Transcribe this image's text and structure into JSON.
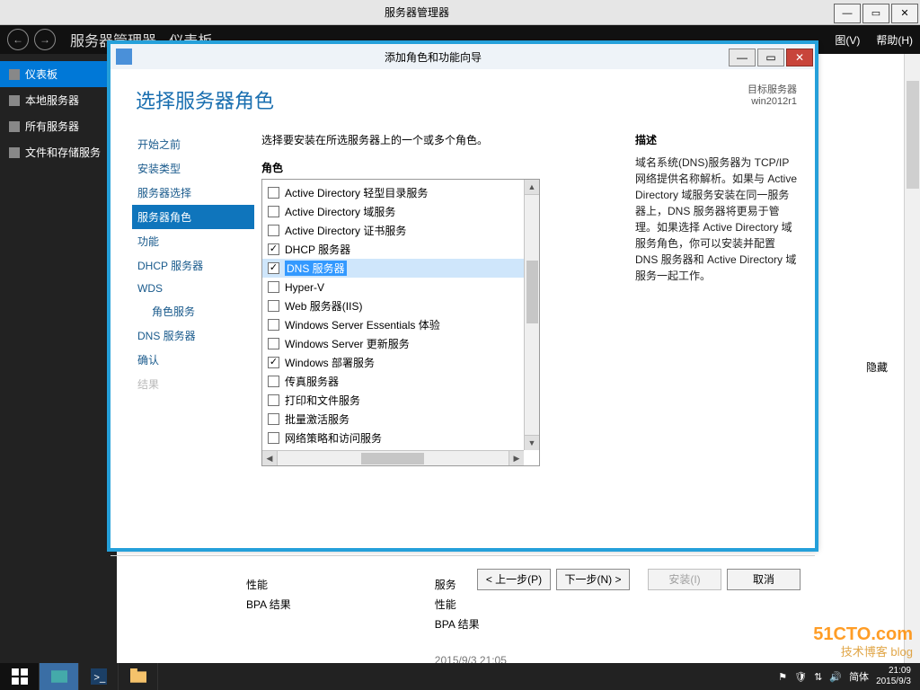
{
  "outer": {
    "title": "服务器管理器",
    "menus": {
      "view": "图(V)",
      "help": "帮助(H)"
    },
    "breadcrumb_hint": "服务器管理器 · 仪表板"
  },
  "leftnav": {
    "items": [
      {
        "label": "仪表板",
        "selected": true
      },
      {
        "label": "本地服务器",
        "selected": false
      },
      {
        "label": "所有服务器",
        "selected": false
      },
      {
        "label": "文件和存储服务",
        "selected": false
      }
    ]
  },
  "main": {
    "hide": "隐藏",
    "tile1": {
      "a": "性能",
      "b": "BPA 结果"
    },
    "tile2": {
      "a": "服务",
      "b": "性能",
      "c": "BPA 结果",
      "ts": "2015/9/3 21:05"
    }
  },
  "wizard": {
    "title": "添加角色和功能向导",
    "heading": "选择服务器角色",
    "dest_label": "目标服务器",
    "dest_value": "win2012r1",
    "steps": [
      {
        "label": "开始之前",
        "state": "link"
      },
      {
        "label": "安装类型",
        "state": "link"
      },
      {
        "label": "服务器选择",
        "state": "link"
      },
      {
        "label": "服务器角色",
        "state": "current"
      },
      {
        "label": "功能",
        "state": "link"
      },
      {
        "label": "DHCP 服务器",
        "state": "link"
      },
      {
        "label": "WDS",
        "state": "link"
      },
      {
        "label": "角色服务",
        "state": "link",
        "indent": true
      },
      {
        "label": "DNS 服务器",
        "state": "link"
      },
      {
        "label": "确认",
        "state": "link"
      },
      {
        "label": "结果",
        "state": "disabled"
      }
    ],
    "prompt": "选择要安装在所选服务器上的一个或多个角色。",
    "roles_header": "角色",
    "roles": [
      {
        "label": "Active Directory 轻型目录服务",
        "checked": false
      },
      {
        "label": "Active Directory 域服务",
        "checked": false
      },
      {
        "label": "Active Directory 证书服务",
        "checked": false
      },
      {
        "label": "DHCP 服务器",
        "checked": true
      },
      {
        "label": "DNS 服务器",
        "checked": true,
        "selected": true
      },
      {
        "label": "Hyper-V",
        "checked": false
      },
      {
        "label": "Web 服务器(IIS)",
        "checked": false
      },
      {
        "label": "Windows Server Essentials 体验",
        "checked": false
      },
      {
        "label": "Windows Server 更新服务",
        "checked": false
      },
      {
        "label": "Windows 部署服务",
        "checked": true
      },
      {
        "label": "传真服务器",
        "checked": false
      },
      {
        "label": "打印和文件服务",
        "checked": false
      },
      {
        "label": "批量激活服务",
        "checked": false
      },
      {
        "label": "网络策略和访问服务",
        "checked": false
      }
    ],
    "desc_header": "描述",
    "desc_text": "域名系统(DNS)服务器为 TCP/IP 网络提供名称解析。如果与 Active Directory 域服务安装在同一服务器上，DNS 服务器将更易于管理。如果选择 Active Directory 域服务角色，你可以安装并配置 DNS 服务器和 Active Directory 域服务一起工作。",
    "buttons": {
      "prev": "< 上一步(P)",
      "next": "下一步(N) >",
      "install": "安装(I)",
      "cancel": "取消"
    }
  },
  "taskbar": {
    "clock_time": "21:09",
    "clock_date": "2015/9/3",
    "ime": "简体"
  },
  "watermark": {
    "main": "51CTO.com",
    "sub": "技术博客  blog"
  }
}
